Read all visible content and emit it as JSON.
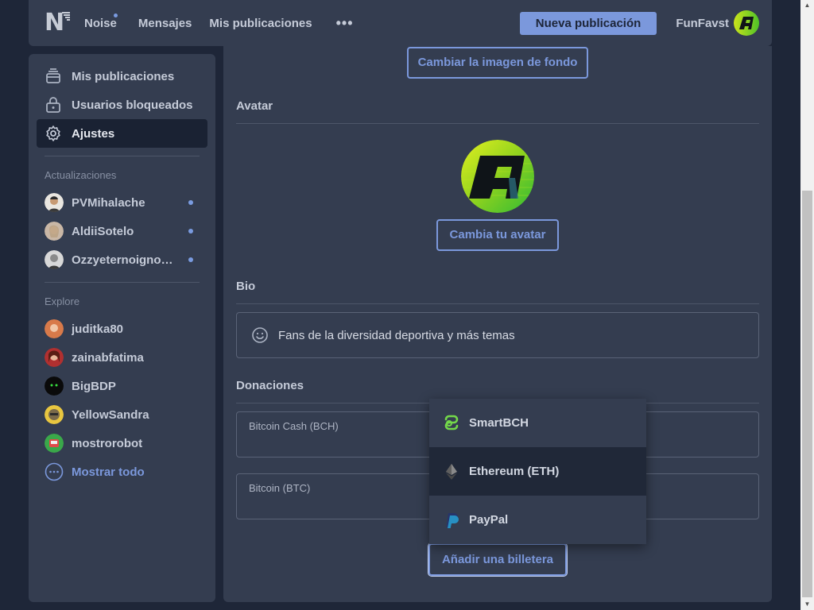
{
  "nav": {
    "brand": "Noise",
    "messages": "Mensajes",
    "my_posts": "Mis publicaciones",
    "more": "•••",
    "new_post": "Nueva publicación",
    "username": "FunFavst"
  },
  "sidebar": {
    "items": [
      {
        "label": "Mis publicaciones",
        "icon": "stack-icon"
      },
      {
        "label": "Usuarios bloqueados",
        "icon": "lock-icon"
      },
      {
        "label": "Ajustes",
        "icon": "gear-icon"
      }
    ],
    "updates_heading": "Actualizaciones",
    "updates": [
      {
        "name": "PVMihalache"
      },
      {
        "name": "AldiiSotelo"
      },
      {
        "name": "Ozzyeternoignor…"
      }
    ],
    "explore_heading": "Explore",
    "explore": [
      {
        "name": "juditka80"
      },
      {
        "name": "zainabfatima"
      },
      {
        "name": "BigBDP"
      },
      {
        "name": "YellowSandra"
      },
      {
        "name": "mostrorobot"
      }
    ],
    "show_all": "Mostrar todo"
  },
  "settings": {
    "change_bg": "Cambiar la imagen de fondo",
    "avatar_title": "Avatar",
    "change_avatar": "Cambia tu avatar",
    "bio_title": "Bio",
    "bio_text": "Fans de la diversidad deportiva y más temas",
    "donations_title": "Donaciones",
    "donation_fields": [
      {
        "label": "Bitcoin Cash (BCH)"
      },
      {
        "label": "Bitcoin (BTC)"
      }
    ],
    "add_wallet": "Añadir una billetera"
  },
  "dropdown": {
    "options": [
      {
        "label": "SmartBCH",
        "icon": "smartbch-icon"
      },
      {
        "label": "Ethereum (ETH)",
        "icon": "ethereum-icon"
      },
      {
        "label": "PayPal",
        "icon": "paypal-icon"
      }
    ],
    "highlighted_index": 1
  },
  "colors": {
    "accent": "#7b98dc",
    "background": "#1e2638",
    "panel": "#343d50"
  }
}
